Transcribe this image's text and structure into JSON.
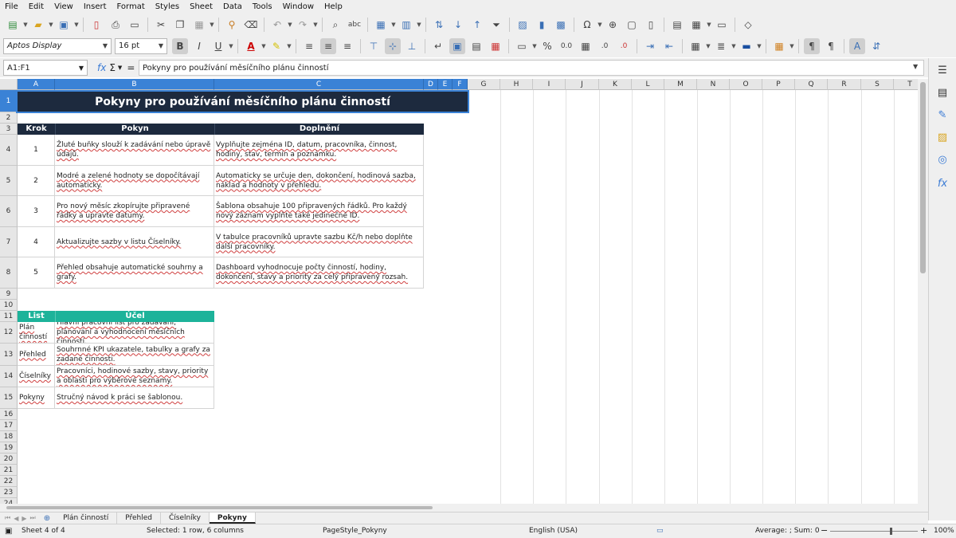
{
  "menu": [
    "File",
    "Edit",
    "View",
    "Insert",
    "Format",
    "Styles",
    "Sheet",
    "Data",
    "Tools",
    "Window",
    "Help"
  ],
  "font": {
    "name": "Aptos Display",
    "size": "16 pt"
  },
  "namebox": "A1:F1",
  "formula": "Pokyny pro používání měsíčního plánu činností",
  "columns": [
    "A",
    "B",
    "C",
    "D",
    "E",
    "F",
    "G",
    "H",
    "I",
    "J",
    "K",
    "L",
    "M",
    "N",
    "O",
    "P",
    "Q",
    "R",
    "S",
    "T"
  ],
  "rows": [
    "1",
    "2",
    "3",
    "4",
    "5",
    "6",
    "7",
    "8",
    "9",
    "10",
    "11",
    "12",
    "13",
    "14",
    "15",
    "16",
    "17",
    "18",
    "19",
    "20",
    "21",
    "22",
    "23",
    "24"
  ],
  "title": "Pokyny pro používání měsíčního plánu činností",
  "steps_header": {
    "krok": "Krok",
    "pokyn": "Pokyn",
    "doplneni": "Doplnění"
  },
  "steps": [
    {
      "krok": "1",
      "pokyn": "Žluté buňky slouží k zadávání nebo úpravě údajů.",
      "doplneni": "Vyplňujte zejména ID, datum, pracovníka, činnost, hodiny, stav, termín a poznámku."
    },
    {
      "krok": "2",
      "pokyn": "Modré a zelené hodnoty se dopočítávají automaticky.",
      "doplneni": "Automaticky se určuje den, dokončení, hodinová sazba, náklad a hodnoty v přehledu."
    },
    {
      "krok": "3",
      "pokyn": "Pro nový měsíc zkopírujte připravené řádky a upravte datumy.",
      "doplneni": "Šablona obsahuje 100 připravených řádků. Pro každý nový záznam vyplňte také jedinečné ID."
    },
    {
      "krok": "4",
      "pokyn": "Aktualizujte sazby v listu Číselníky.",
      "doplneni": "V tabulce pracovníků upravte sazbu Kč/h nebo doplňte další pracovníky."
    },
    {
      "krok": "5",
      "pokyn": "Přehled obsahuje automatické souhrny a grafy.",
      "doplneni": "Dashboard vyhodnocuje počty činností, hodiny, dokončení, stavy a priority za celý připravený rozsah."
    }
  ],
  "sheets_header": {
    "list": "List",
    "ucel": "Účel"
  },
  "sheets": [
    {
      "list": "Plán činností",
      "ucel": "Hlavní pracovní list pro zadávání, plánování a vyhodnocení měsíčních činností."
    },
    {
      "list": "Přehled",
      "ucel": "Souhrnné KPI ukazatele, tabulky a grafy za zadané činnosti."
    },
    {
      "list": "Číselníky",
      "ucel": "Pracovníci, hodinové sazby, stavy, priority a oblasti pro výběrové seznamy."
    },
    {
      "list": "Pokyny",
      "ucel": "Stručný návod k práci se šablonou."
    }
  ],
  "tabs": [
    "Plán činností",
    "Přehled",
    "Číselníky",
    "Pokyny"
  ],
  "status": {
    "sheet": "Sheet 4 of 4",
    "selection": "Selected: 1 row, 6 columns",
    "pagestyle": "PageStyle_Pokyny",
    "lang": "English (USA)",
    "sum": "Average: ; Sum: 0",
    "zoom": "100%"
  },
  "colors": {
    "header_dark": "#1d2a3e",
    "header_teal": "#1db39a",
    "selection": "#3a82d6"
  }
}
